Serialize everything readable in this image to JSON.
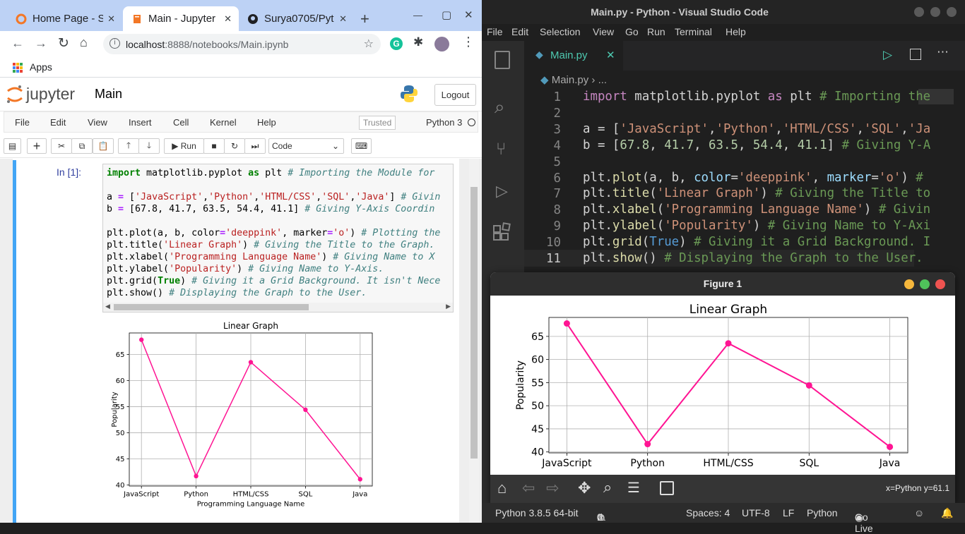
{
  "browser": {
    "tabs": [
      {
        "label": "Home Page - Se",
        "icon": "jupyter-icon"
      },
      {
        "label": "Main - Jupyter",
        "icon": "notebook-icon"
      },
      {
        "label": "Surya0705/Pyt",
        "icon": "github-icon"
      }
    ],
    "url_host": "localhost",
    "url_rest": ":8888/notebooks/Main.ipynb",
    "bookmarks_apps": "Apps"
  },
  "jupyter": {
    "logo_text": "jupyter",
    "notebook_name": "Main",
    "logout_label": "Logout",
    "menu": [
      "File",
      "Edit",
      "View",
      "Insert",
      "Cell",
      "Kernel",
      "Help"
    ],
    "trusted_label": "Trusted",
    "kernel_label": "Python 3",
    "run_label": "Run",
    "cell_type": "Code",
    "prompt": "In [1]:",
    "code_lines": [
      "import matplotlib.pyplot as plt # Importing the Module for",
      "",
      "a = ['JavaScript','Python','HTML/CSS','SQL','Java'] # Givin",
      "b = [67.8, 41.7, 63.5, 54.4, 41.1] # Giving Y-Axis Coordin",
      "",
      "plt.plot(a, b, color='deeppink', marker='o') # Plotting the",
      "plt.title('Linear Graph') # Giving the Title to the Graph.",
      "plt.xlabel('Programming Language Name') # Giving Name to X",
      "plt.ylabel('Popularity') # Giving Name to Y-Axis.",
      "plt.grid(True) # Giving it a Grid Background. It isn't Nece",
      "plt.show() # Displaying the Graph to the User."
    ]
  },
  "vscode": {
    "window_title": "Main.py - Python - Visual Studio Code",
    "menu": [
      "File",
      "Edit",
      "Selection",
      "View",
      "Go",
      "Run",
      "Terminal",
      "Help"
    ],
    "tab_label": "Main.py",
    "breadcrumb_file": "Main.py",
    "breadcrumb_more": "...",
    "line_numbers": [
      "1",
      "2",
      "3",
      "4",
      "5",
      "6",
      "7",
      "8",
      "9",
      "10",
      "11"
    ],
    "code_lines": [
      "import matplotlib.pyplot as plt # Importing the",
      "",
      "a = ['JavaScript','Python','HTML/CSS','SQL','Ja",
      "b = [67.8, 41.7, 63.5, 54.4, 41.1] # Giving Y-A",
      "",
      "plt.plot(a, b, color='deeppink', marker='o') #",
      "plt.title('Linear Graph') # Giving the Title to",
      "plt.xlabel('Programming Language Name') # Givin",
      "plt.ylabel('Popularity') # Giving Name to Y-Axi",
      "plt.grid(True) # Giving it a Grid Background. I",
      "plt.show() # Displaying the Graph to the User."
    ],
    "status": {
      "interpreter": "Python 3.8.5 64-bit",
      "errors": "0",
      "warnings": "0",
      "spaces": "Spaces: 4",
      "encoding": "UTF-8",
      "eol": "LF",
      "language": "Python",
      "golive": "Go Live"
    }
  },
  "figure_window": {
    "title": "Figure 1",
    "coords": "x=Python y=61.1"
  },
  "chart_data": [
    {
      "type": "line",
      "title": "Linear Graph",
      "xlabel": "Programming Language Name",
      "ylabel": "Popularity",
      "categories": [
        "JavaScript",
        "Python",
        "HTML/CSS",
        "SQL",
        "Java"
      ],
      "values": [
        67.8,
        41.7,
        63.5,
        54.4,
        41.1
      ],
      "yticks": [
        40,
        45,
        50,
        55,
        60,
        65
      ],
      "ylim": [
        39.8,
        69.1
      ],
      "grid": true,
      "color": "#ff1493",
      "marker": "o"
    },
    {
      "type": "line",
      "title": "Linear Graph",
      "xlabel": "",
      "ylabel": "Popularity",
      "categories": [
        "JavaScript",
        "Python",
        "HTML/CSS",
        "SQL",
        "Java"
      ],
      "values": [
        67.8,
        41.7,
        63.5,
        54.4,
        41.1
      ],
      "yticks": [
        40,
        45,
        50,
        55,
        60,
        65
      ],
      "ylim": [
        39.8,
        69.1
      ],
      "grid": true,
      "color": "#ff1493",
      "marker": "o"
    }
  ]
}
